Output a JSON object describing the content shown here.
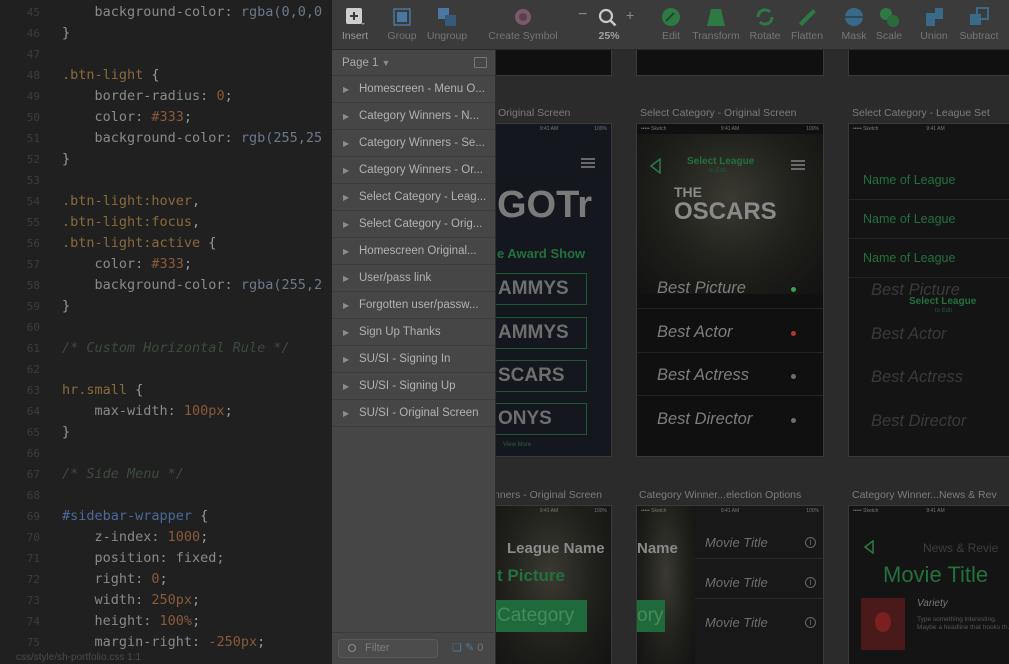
{
  "editor": {
    "lines": [
      {
        "n": "45",
        "parts": [
          {
            "c": "t-prop",
            "t": "    background-color: "
          },
          {
            "c": "t-fn",
            "t": "rgba(0,0,0"
          }
        ]
      },
      {
        "n": "46",
        "parts": [
          {
            "c": "",
            "t": "}"
          }
        ]
      },
      {
        "n": "47",
        "parts": [
          {
            "c": "",
            "t": ""
          }
        ]
      },
      {
        "n": "48",
        "parts": [
          {
            "c": "t-sel",
            "t": ".btn-light"
          },
          {
            "c": "",
            "t": " {"
          }
        ]
      },
      {
        "n": "49",
        "parts": [
          {
            "c": "t-prop",
            "t": "    border-radius: "
          },
          {
            "c": "t-num",
            "t": "0"
          },
          {
            "c": "",
            "t": ";"
          }
        ]
      },
      {
        "n": "50",
        "parts": [
          {
            "c": "t-prop",
            "t": "    color: "
          },
          {
            "c": "t-num",
            "t": "#333"
          },
          {
            "c": "",
            "t": ";"
          }
        ]
      },
      {
        "n": "51",
        "parts": [
          {
            "c": "t-prop",
            "t": "    background-color: "
          },
          {
            "c": "t-fn",
            "t": "rgb(255,25"
          }
        ]
      },
      {
        "n": "52",
        "parts": [
          {
            "c": "",
            "t": "}"
          }
        ]
      },
      {
        "n": "53",
        "parts": [
          {
            "c": "",
            "t": ""
          }
        ]
      },
      {
        "n": "54",
        "parts": [
          {
            "c": "t-sel",
            "t": ".btn-light:hover"
          },
          {
            "c": "",
            "t": ","
          }
        ]
      },
      {
        "n": "55",
        "parts": [
          {
            "c": "t-sel",
            "t": ".btn-light:focus"
          },
          {
            "c": "",
            "t": ","
          }
        ]
      },
      {
        "n": "56",
        "parts": [
          {
            "c": "t-sel",
            "t": ".btn-light:active"
          },
          {
            "c": "",
            "t": " {"
          }
        ]
      },
      {
        "n": "57",
        "parts": [
          {
            "c": "t-prop",
            "t": "    color: "
          },
          {
            "c": "t-num",
            "t": "#333"
          },
          {
            "c": "",
            "t": ";"
          }
        ]
      },
      {
        "n": "58",
        "parts": [
          {
            "c": "t-prop",
            "t": "    background-color: "
          },
          {
            "c": "t-fn",
            "t": "rgba(255,2"
          }
        ]
      },
      {
        "n": "59",
        "parts": [
          {
            "c": "",
            "t": "}"
          }
        ]
      },
      {
        "n": "60",
        "parts": [
          {
            "c": "",
            "t": ""
          }
        ]
      },
      {
        "n": "61",
        "parts": [
          {
            "c": "t-cmt",
            "t": "/* Custom Horizontal Rule */"
          }
        ]
      },
      {
        "n": "62",
        "parts": [
          {
            "c": "",
            "t": ""
          }
        ]
      },
      {
        "n": "63",
        "parts": [
          {
            "c": "t-sel",
            "t": "hr.small"
          },
          {
            "c": "",
            "t": " {"
          }
        ]
      },
      {
        "n": "64",
        "parts": [
          {
            "c": "t-prop",
            "t": "    max-width: "
          },
          {
            "c": "t-num",
            "t": "100px"
          },
          {
            "c": "",
            "t": ";"
          }
        ]
      },
      {
        "n": "65",
        "parts": [
          {
            "c": "",
            "t": "}"
          }
        ]
      },
      {
        "n": "66",
        "parts": [
          {
            "c": "",
            "t": ""
          }
        ]
      },
      {
        "n": "67",
        "parts": [
          {
            "c": "t-cmt",
            "t": "/* Side Menu */"
          }
        ]
      },
      {
        "n": "68",
        "parts": [
          {
            "c": "",
            "t": ""
          }
        ]
      },
      {
        "n": "69",
        "parts": [
          {
            "c": "t-id",
            "t": "#sidebar-wrapper"
          },
          {
            "c": "",
            "t": " {"
          }
        ]
      },
      {
        "n": "70",
        "parts": [
          {
            "c": "t-prop",
            "t": "    z-index: "
          },
          {
            "c": "t-num",
            "t": "1000"
          },
          {
            "c": "",
            "t": ";"
          }
        ]
      },
      {
        "n": "71",
        "parts": [
          {
            "c": "t-prop",
            "t": "    position: fixed;"
          }
        ]
      },
      {
        "n": "72",
        "parts": [
          {
            "c": "t-prop",
            "t": "    right: "
          },
          {
            "c": "t-num",
            "t": "0"
          },
          {
            "c": "",
            "t": ";"
          }
        ]
      },
      {
        "n": "73",
        "parts": [
          {
            "c": "t-prop",
            "t": "    width: "
          },
          {
            "c": "t-num",
            "t": "250px"
          },
          {
            "c": "",
            "t": ";"
          }
        ]
      },
      {
        "n": "74",
        "parts": [
          {
            "c": "t-prop",
            "t": "    height: "
          },
          {
            "c": "t-num",
            "t": "100%"
          },
          {
            "c": "",
            "t": ";"
          }
        ]
      },
      {
        "n": "75",
        "parts": [
          {
            "c": "t-prop",
            "t": "    margin-right: "
          },
          {
            "c": "t-num",
            "t": "-250px"
          },
          {
            "c": "",
            "t": ";"
          }
        ]
      }
    ],
    "status": "css/style/sh-portfolio.css    1:1"
  },
  "toolbar": {
    "insert": "Insert",
    "group": "Group",
    "ungroup": "Ungroup",
    "create_symbol": "Create Symbol",
    "zoom": "25%",
    "zoom_minus": "−",
    "zoom_plus": "+",
    "edit": "Edit",
    "transform": "Transform",
    "rotate": "Rotate",
    "flatten": "Flatten",
    "mask": "Mask",
    "scale": "Scale",
    "union": "Union",
    "subtract": "Subtract"
  },
  "layers": {
    "page": "Page 1",
    "items": [
      "Homescreen - Menu O...",
      "Category Winners - N...",
      "Category Winners - Se...",
      "Category Winners - Or...",
      "Select Category - Leag...",
      "Select Category - Orig...",
      "Homescreen Original...",
      "User/pass link",
      "Forgotten user/passw...",
      "Sign Up Thanks",
      "SU/SI - Signing In",
      "SU/SI - Signing Up",
      "SU/SI - Original Screen"
    ],
    "filter_placeholder": "Filter",
    "filter_count": "0"
  },
  "artboards": {
    "titles": {
      "a1": "Original Screen",
      "a2": "Select Category - Original Screen",
      "a3": "Select Category - League Set",
      "a4": "nners - Original Screen",
      "a5": "Category Winner...election Options",
      "a6": "Category Winner...News & Rev"
    },
    "status_bar": {
      "carrier": "••••• Sketch",
      "time": "9:41 AM",
      "battery": "100%"
    },
    "a1": {
      "logo": "GOTr",
      "subtitle": "e Award Show",
      "buttons": [
        "AMMYS",
        "AMMYS",
        "SCARS",
        "ONYS"
      ],
      "more": "View More"
    },
    "a2": {
      "header": "Select League",
      "sub": "to Edit",
      "title1": "THE",
      "title2": "OSCARS",
      "categories": [
        "Best Picture",
        "Best Actor",
        "Best Actress",
        "Best Director"
      ]
    },
    "a3": {
      "leagues": [
        "Name of League",
        "Name of League",
        "Name of League",
        "Name of League"
      ],
      "header": "Select League",
      "sub": "to Edit",
      "categories": [
        "Best Picture",
        "Best Actor",
        "Best Actress",
        "Best Director"
      ]
    },
    "a4": {
      "league": "League Name",
      "title": "t Picture",
      "button": "Category"
    },
    "a5": {
      "name": "Name",
      "button": "ory",
      "movies": [
        "Movie Title",
        "Movie Title",
        "Movie Title"
      ]
    },
    "a6": {
      "tab": "News & Revie",
      "title": "Movie Title",
      "source": "Variety",
      "body": "Type something interesting. Maybe a headline that hooks th..."
    }
  },
  "colors": {
    "accent_green": "#22713e",
    "dot_green": "#3aa34a",
    "dot_red": "#b8352e",
    "dot_gray": "#6e6e6e"
  }
}
